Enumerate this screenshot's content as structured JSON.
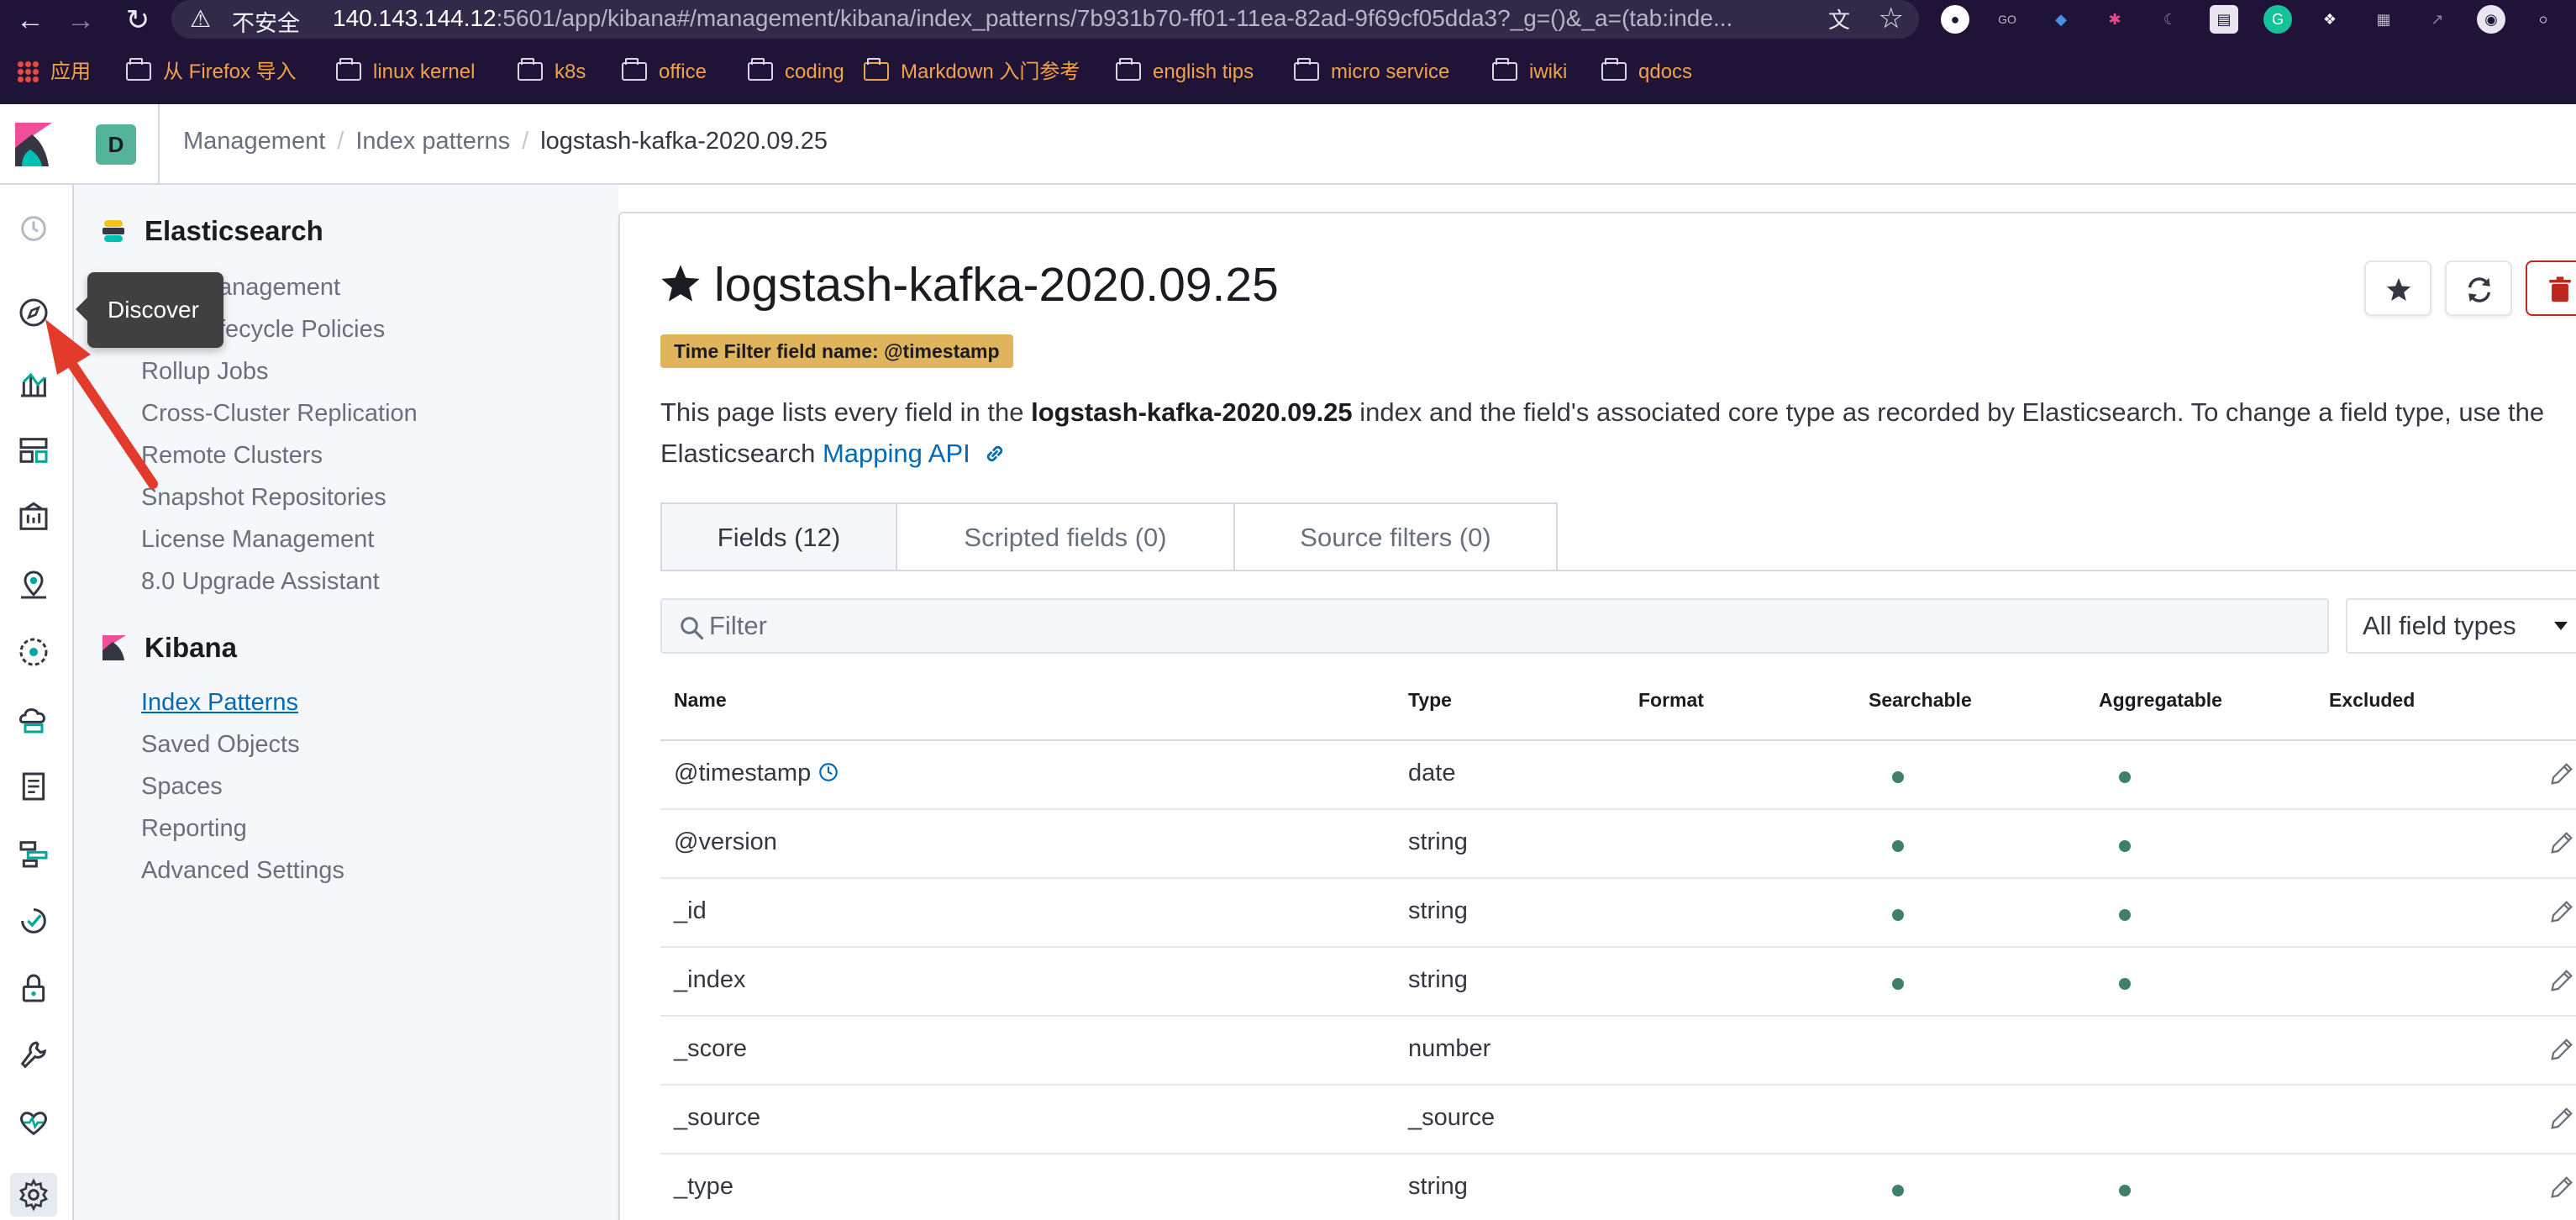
{
  "browser": {
    "security_label": "不安全",
    "url_host": "140.143.144.12",
    "url_path": ":5601/app/kibana#/management/kibana/index_patterns/7b931b70-ff01-11ea-82ad-9f69cf05dda3?_g=()&_a=(tab:inde...",
    "bookmarks": [
      "应用",
      "从 Firefox 导入",
      "linux kernel",
      "k8s",
      "office",
      "coding",
      "Markdown 入门参考",
      "english tips",
      "micro service",
      "iwiki",
      "qdocs"
    ],
    "colors": {
      "chrome_bg": "#1f1438",
      "bookmark_text": "#f0a24a"
    }
  },
  "header": {
    "space_initial": "D",
    "breadcrumbs": [
      "Management",
      "Index patterns",
      "logstash-kafka-2020.09.25"
    ]
  },
  "nav_rail": {
    "icons": [
      "recently-viewed-icon",
      "discover-icon",
      "visualize-icon",
      "dashboard-icon",
      "canvas-icon",
      "maps-icon",
      "ml-icon",
      "infrastructure-icon",
      "logs-icon",
      "apm-icon",
      "uptime-icon",
      "siem-icon",
      "dev-tools-icon",
      "monitoring-icon",
      "management-icon"
    ],
    "tooltip": "Discover"
  },
  "sidebar": {
    "elasticsearch": {
      "title": "Elasticsearch",
      "items": [
        "Index Management",
        "Index Lifecycle Policies",
        "Rollup Jobs",
        "Cross-Cluster Replication",
        "Remote Clusters",
        "Snapshot Repositories",
        "License Management",
        "8.0 Upgrade Assistant"
      ],
      "visible_items": [
        "anagement",
        "fecycle Policies",
        "Rollup Jobs",
        "Cross-Cluster Replication",
        "Remote Clusters",
        "Snapshot Repositories",
        "License Management",
        "8.0 Upgrade Assistant"
      ]
    },
    "kibana": {
      "title": "Kibana",
      "items": [
        "Index Patterns",
        "Saved Objects",
        "Spaces",
        "Reporting",
        "Advanced Settings"
      ],
      "active_index": 0
    }
  },
  "main": {
    "title": "logstash-kafka-2020.09.25",
    "time_filter_badge": "Time Filter field name: @timestamp",
    "description": {
      "part1": "This page lists every field in the ",
      "index_name": "logstash-kafka-2020.09.25",
      "part2": " index and the field's associated core type as recorded by Elasticsearch. To change a field type, use the Elasticsearch ",
      "link": "Mapping API"
    },
    "tabs": [
      "Fields (12)",
      "Scripted fields (0)",
      "Source filters (0)"
    ],
    "filter_placeholder": "Filter",
    "field_type_select": "All field types",
    "columns": [
      "Name",
      "Type",
      "Format",
      "Searchable",
      "Aggregatable",
      "Excluded"
    ],
    "rows": [
      {
        "name": "@timestamp",
        "type": "date",
        "searchable": true,
        "aggregatable": true,
        "time_field": true
      },
      {
        "name": "@version",
        "type": "string",
        "searchable": true,
        "aggregatable": true
      },
      {
        "name": "_id",
        "type": "string",
        "searchable": true,
        "aggregatable": true
      },
      {
        "name": "_index",
        "type": "string",
        "searchable": true,
        "aggregatable": true
      },
      {
        "name": "_score",
        "type": "number",
        "searchable": false,
        "aggregatable": false
      },
      {
        "name": "_source",
        "type": "_source",
        "searchable": false,
        "aggregatable": false
      },
      {
        "name": "_type",
        "type": "string",
        "searchable": true,
        "aggregatable": true
      }
    ],
    "colors": {
      "accent": "#006bb4",
      "badge": "#e0b45a",
      "dot": "#3f7f6e",
      "danger": "#bd271e"
    }
  }
}
